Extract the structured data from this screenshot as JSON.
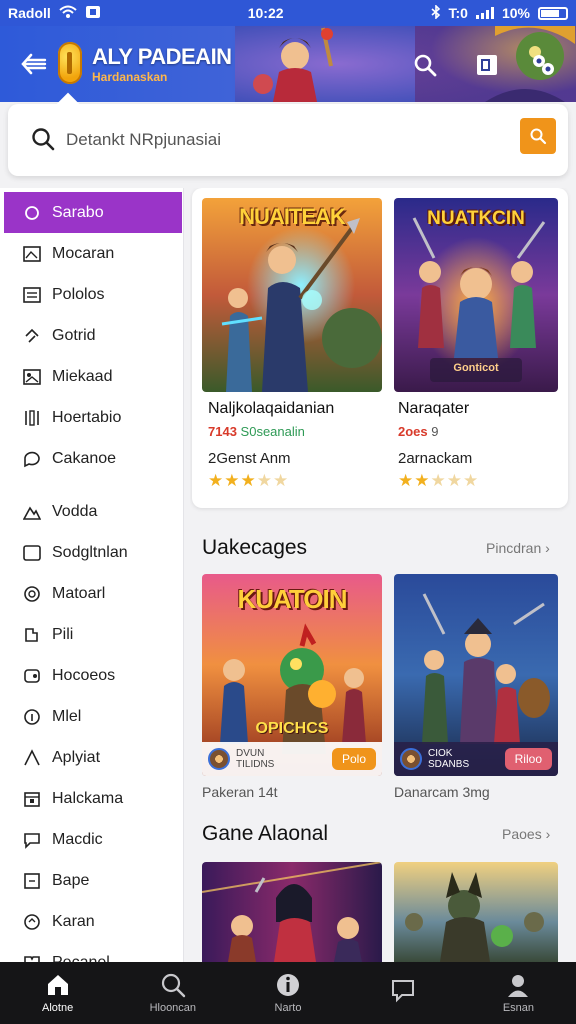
{
  "status_bar": {
    "carrier": "Radoll",
    "time": "10:22",
    "battery": "10%",
    "network": "T:0"
  },
  "header": {
    "title": "ALY PADEAIN",
    "subtitle": "Hardanaskan"
  },
  "search": {
    "placeholder": "Detankt NRpjunasiai"
  },
  "sidebar": {
    "items": [
      {
        "label": "Sarabo",
        "icon": "circle-icon"
      },
      {
        "label": "Mocaran",
        "icon": "image-icon"
      },
      {
        "label": "Pololos",
        "icon": "list-icon"
      },
      {
        "label": "Gotrid",
        "icon": "link-icon"
      },
      {
        "label": "Miekaad",
        "icon": "photo-icon"
      },
      {
        "label": "Hoertabio",
        "icon": "columns-icon"
      },
      {
        "label": "Cakanoe",
        "icon": "chat-icon"
      },
      {
        "label": "Vodda",
        "icon": "mountain-icon"
      },
      {
        "label": "Sodgltnlan",
        "icon": "square-icon"
      },
      {
        "label": "Matoarl",
        "icon": "shield-icon"
      },
      {
        "label": "Pili",
        "icon": "puzzle-icon"
      },
      {
        "label": "Hocoeos",
        "icon": "tag-icon"
      },
      {
        "label": "Mlel",
        "icon": "info-icon"
      },
      {
        "label": "Aplyiat",
        "icon": "send-icon"
      },
      {
        "label": "Halckama",
        "icon": "calendar-icon"
      },
      {
        "label": "Macdic",
        "icon": "message-icon"
      },
      {
        "label": "Bape",
        "icon": "box-icon"
      },
      {
        "label": "Karan",
        "icon": "headphones-icon"
      },
      {
        "label": "Pecanel",
        "icon": "book-icon"
      }
    ]
  },
  "featured": {
    "games": [
      {
        "cover_title": "NUAITEAK",
        "name": "Naljkolaqaidanian",
        "price": "7143",
        "tag": "S0seanalin",
        "developer": "2Genst Anm",
        "rating": 3.5
      },
      {
        "cover_title": "NUATKCIN",
        "cover_subtitle": "Gonticot",
        "name": "Naraqater",
        "price": "2oes",
        "tag": "9",
        "developer": "2arnackam",
        "rating": 2.5
      }
    ]
  },
  "section_upcoming": {
    "title": "Uakecages",
    "link": "Pincdran",
    "games": [
      {
        "cover_title": "KUATOIN",
        "cover_subtitle": "OPICHCS",
        "promo_text": "DVUN\nTILIDNS",
        "button": "Polo",
        "caption": "Pakeran 14t"
      },
      {
        "cover_title": "",
        "promo_text": "CIOK\nSDANBS",
        "button": "Riloo",
        "caption": "Danarcam 3mg"
      }
    ]
  },
  "section_game": {
    "title": "Gane Alaonal",
    "link": "Paoes"
  },
  "bottom_nav": [
    {
      "label": "Alotne",
      "icon": "home-icon",
      "active": true
    },
    {
      "label": "Hlooncan",
      "icon": "search-icon",
      "active": false
    },
    {
      "label": "Narto",
      "icon": "info-icon",
      "active": false
    },
    {
      "label": "",
      "icon": "chat-bubble-icon",
      "active": false
    },
    {
      "label": "Esnan",
      "icon": "profile-icon",
      "active": false
    }
  ],
  "colors": {
    "header_blue": "#2f57d6",
    "accent_orange": "#f0941a",
    "active_purple": "#9a34c8",
    "nav_dark": "#151517",
    "star_gold": "#f2b01e"
  }
}
